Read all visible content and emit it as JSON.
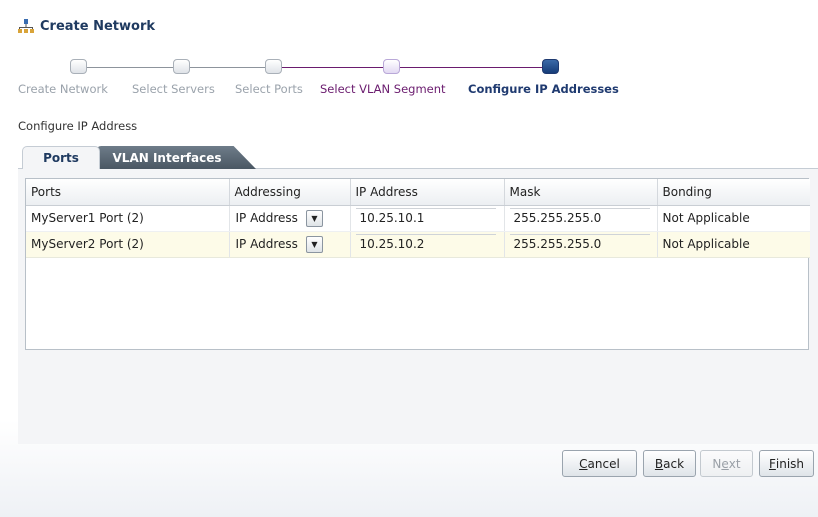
{
  "header": {
    "title": "Create Network",
    "icon": "network-icon"
  },
  "train": {
    "steps": [
      {
        "label": "Create Network",
        "state": "visited"
      },
      {
        "label": "Select Servers",
        "state": "visited"
      },
      {
        "label": "Select Ports",
        "state": "visited"
      },
      {
        "label": "Select VLAN Segment",
        "state": "next"
      },
      {
        "label": "Configure IP Addresses",
        "state": "current"
      }
    ],
    "colors": {
      "visited": "#9aa2ab",
      "next": "#6a1b6e",
      "current": "#1f3a70"
    }
  },
  "section": {
    "label": "Configure IP Address"
  },
  "tabs": [
    {
      "label": "Ports",
      "selected": true
    },
    {
      "label": "VLAN Interfaces",
      "selected": false
    }
  ],
  "table": {
    "columns": [
      "Ports",
      "Addressing",
      "IP Address",
      "Mask",
      "Bonding"
    ],
    "rows": [
      {
        "port": "MyServer1 Port (2)",
        "addressing": "IP Address",
        "ip": "10.25.10.1",
        "mask": "255.255.255.0",
        "bonding": "Not Applicable"
      },
      {
        "port": "MyServer2 Port (2)",
        "addressing": "IP Address",
        "ip": "10.25.10.2",
        "mask": "255.255.255.0",
        "bonding": "Not Applicable"
      }
    ]
  },
  "buttons": {
    "cancel": {
      "first": "C",
      "rest": "ancel"
    },
    "back": {
      "first": "B",
      "rest": "ack"
    },
    "next": {
      "pre": "N",
      "underline": "e",
      "post": "xt",
      "enabled": false
    },
    "finish": {
      "first": "F",
      "rest": "inish"
    }
  }
}
